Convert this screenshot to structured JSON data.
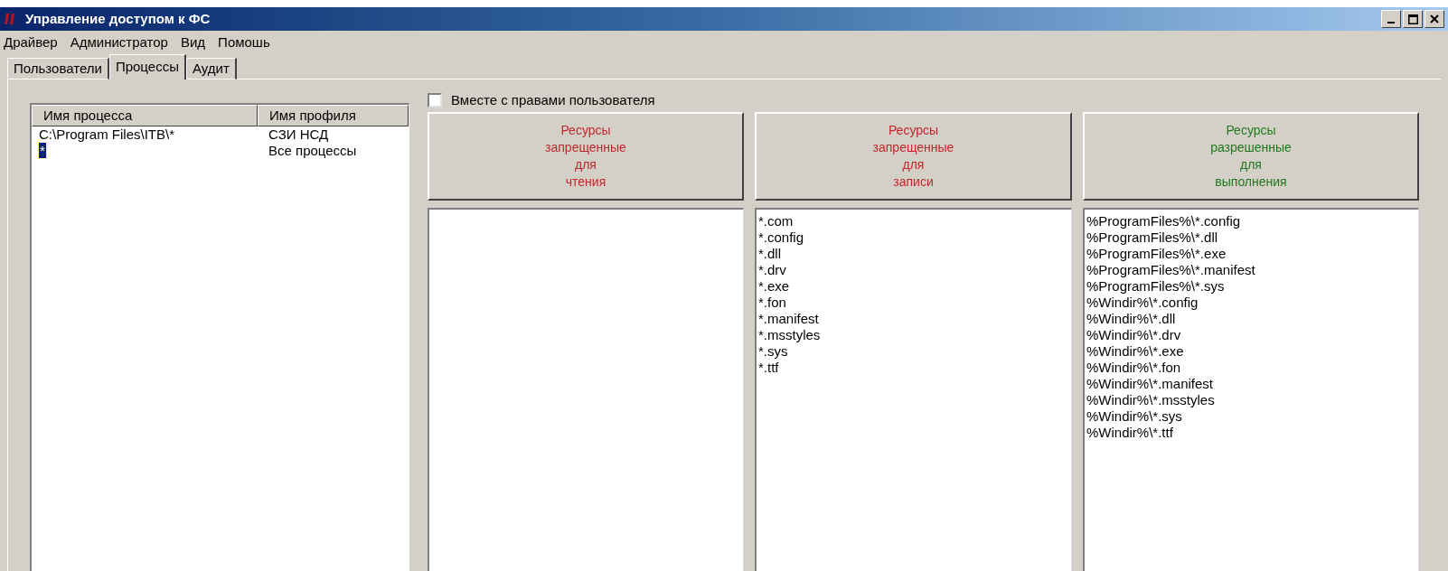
{
  "window": {
    "title": "Управление доступом к ФС"
  },
  "menu": [
    "Драйвер",
    "Администратор",
    "Вид",
    "Помошь"
  ],
  "tabs": [
    {
      "label": "Пользователи",
      "selected": false
    },
    {
      "label": "Процессы",
      "selected": true
    },
    {
      "label": "Аудит",
      "selected": false
    }
  ],
  "process_table": {
    "columns": [
      "Имя процесса",
      "Имя профиля"
    ],
    "rows": [
      {
        "process": "C:\\Program Files\\ITB\\*",
        "profile": "СЗИ НСД",
        "selected": false
      },
      {
        "process": "*",
        "profile": "Все процессы",
        "selected": true
      }
    ]
  },
  "with_user_rights": {
    "label": "Вместе с правами пользователя",
    "checked": false
  },
  "resource_panels": [
    {
      "lines": [
        "Ресурсы",
        "запрещенные",
        "для",
        "чтения"
      ],
      "color": "#c0282d"
    },
    {
      "lines": [
        "Ресурсы",
        "запрещенные",
        "для",
        "записи"
      ],
      "color": "#c0282d",
      "items": [
        "*.com",
        "*.config",
        "*.dll",
        "*.drv",
        "*.exe",
        "*.fon",
        "*.manifest",
        "*.msstyles",
        "*.sys",
        "*.ttf"
      ]
    },
    {
      "lines": [
        "Ресурсы",
        "разрешенные",
        "для",
        "выполнения"
      ],
      "color": "#1f7a1f",
      "items": [
        "%ProgramFiles%\\*.config",
        "%ProgramFiles%\\*.dll",
        "%ProgramFiles%\\*.exe",
        "%ProgramFiles%\\*.manifest",
        "%ProgramFiles%\\*.sys",
        "%Windir%\\*.config",
        "%Windir%\\*.dll",
        "%Windir%\\*.drv",
        "%Windir%\\*.exe",
        "%Windir%\\*.fon",
        "%Windir%\\*.manifest",
        "%Windir%\\*.msstyles",
        "%Windir%\\*.sys",
        "%Windir%\\*.ttf"
      ]
    }
  ]
}
